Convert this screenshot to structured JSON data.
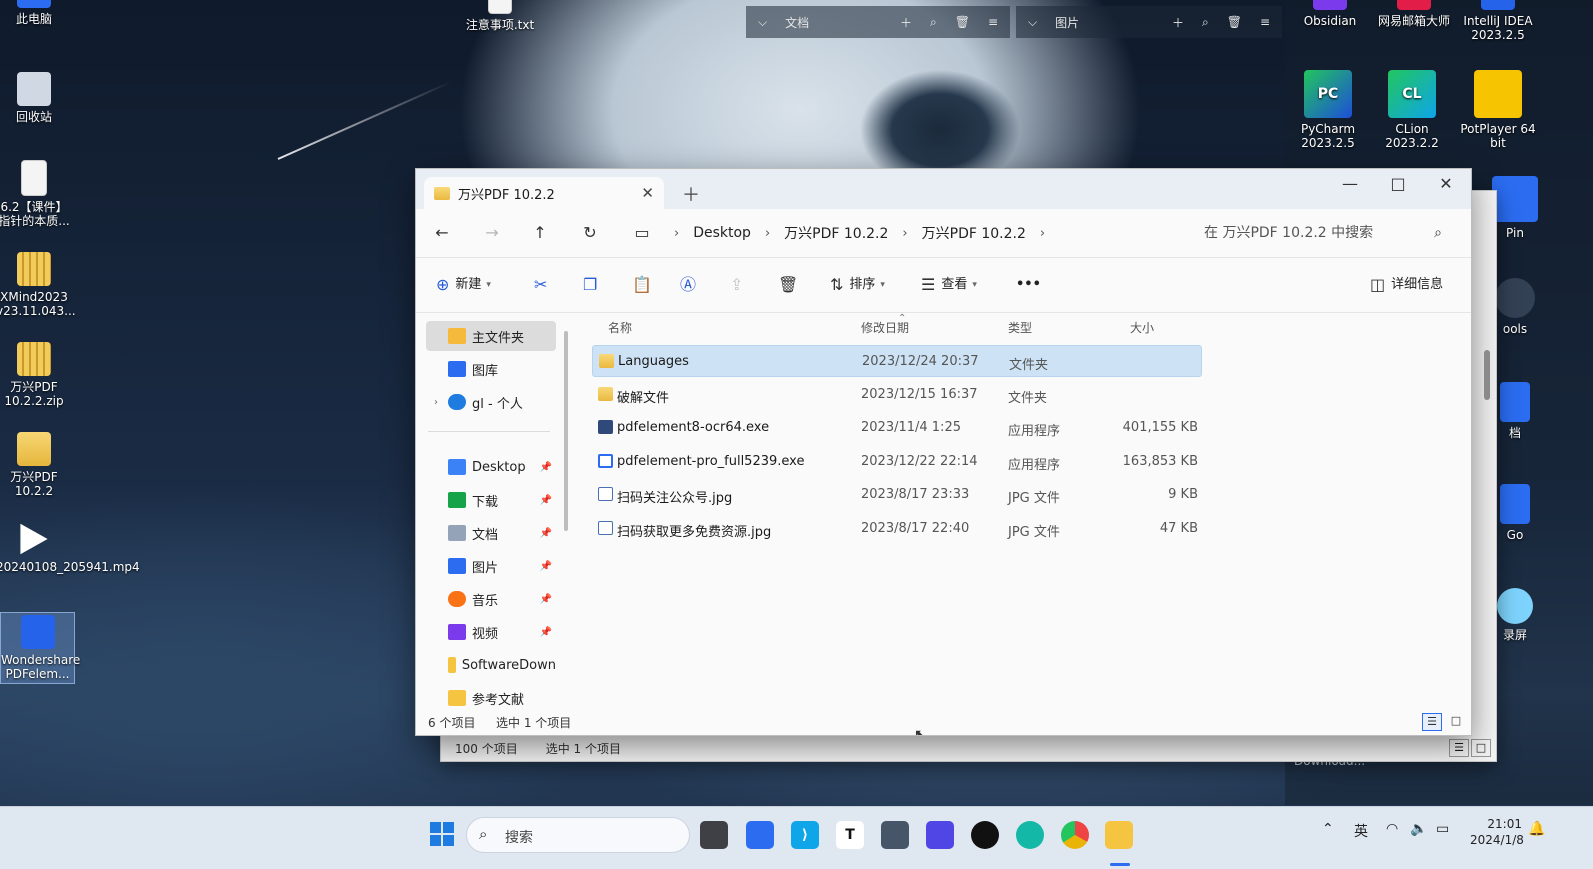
{
  "desktop": {
    "left_icons": [
      {
        "label": "此电脑"
      },
      {
        "label": "回收站"
      },
      {
        "label": "6.2【课件】指针的本质..."
      },
      {
        "label": "XMind2023 v23.11.043..."
      },
      {
        "label": "万兴PDF 10.2.2.zip"
      },
      {
        "label": "万兴PDF 10.2.2"
      },
      {
        "label": "20240108_205941.mp4"
      },
      {
        "label": "Wondershare PDFelem..."
      }
    ],
    "top_icon": {
      "label": "注意事项.txt"
    },
    "right_icons": [
      {
        "label": "Obsidian"
      },
      {
        "label": "网易邮箱大师"
      },
      {
        "label": "IntelliJ IDEA 2023.2.5"
      },
      {
        "label": "PyCharm 2023.2.5",
        "glyph": "PC"
      },
      {
        "label": "CLion 2023.2.2",
        "glyph": "CL"
      },
      {
        "label": "PotPlayer 64 bit"
      }
    ],
    "edge_labels": [
      "Pin",
      "ools",
      "档",
      "Go",
      "录屏"
    ],
    "fence_docs": {
      "label": "文档"
    },
    "fence_pics": {
      "label": "图片"
    },
    "download_text": "Download..."
  },
  "back_window": {
    "status_count": "100 个项目",
    "status_selected": "选中 1 个项目"
  },
  "window": {
    "tab_title": "万兴PDF 10.2.2",
    "breadcrumbs": [
      "Desktop",
      "万兴PDF 10.2.2",
      "万兴PDF 10.2.2"
    ],
    "search_placeholder": "在 万兴PDF 10.2.2 中搜索",
    "toolbar": {
      "new_label": "新建",
      "sort_label": "排序",
      "view_label": "查看",
      "more_label": "•••",
      "details_label": "详细信息"
    },
    "nav": {
      "home": "主文件夹",
      "gallery": "图库",
      "onedrive": "gl - 个人",
      "desktop": "Desktop",
      "downloads": "下载",
      "documents": "文档",
      "pictures": "图片",
      "music": "音乐",
      "videos": "视频",
      "softwaredown": "SoftwareDown",
      "references": "参考文献"
    },
    "columns": {
      "name": "名称",
      "date": "修改日期",
      "type": "类型",
      "size": "大小"
    },
    "files": [
      {
        "name": "Languages",
        "date": "2023/12/24 20:37",
        "type": "文件夹",
        "size": "",
        "icon": "folder-icon",
        "selected": true
      },
      {
        "name": "破解文件",
        "date": "2023/12/15 16:37",
        "type": "文件夹",
        "size": "",
        "icon": "folder-icon",
        "selected": false
      },
      {
        "name": "pdfelement8-ocr64.exe",
        "date": "2023/11/4 1:25",
        "type": "应用程序",
        "size": "401,155 KB",
        "icon": "exe-icon",
        "selected": false
      },
      {
        "name": "pdfelement-pro_full5239.exe",
        "date": "2023/12/22 22:14",
        "type": "应用程序",
        "size": "163,853 KB",
        "icon": "exe-icon",
        "selected": false
      },
      {
        "name": "扫码关注公众号.jpg",
        "date": "2023/8/17 23:33",
        "type": "JPG 文件",
        "size": "9 KB",
        "icon": "image-file-icon",
        "selected": false
      },
      {
        "name": "扫码获取更多免费资源.jpg",
        "date": "2023/8/17 22:40",
        "type": "JPG 文件",
        "size": "47 KB",
        "icon": "image-file-icon",
        "selected": false
      }
    ],
    "status_count": "6 个项目",
    "status_selected": "选中 1 个项目"
  },
  "taskbar": {
    "search_placeholder": "搜索",
    "ime": "英",
    "time": "21:01",
    "date": "2024/1/8"
  }
}
